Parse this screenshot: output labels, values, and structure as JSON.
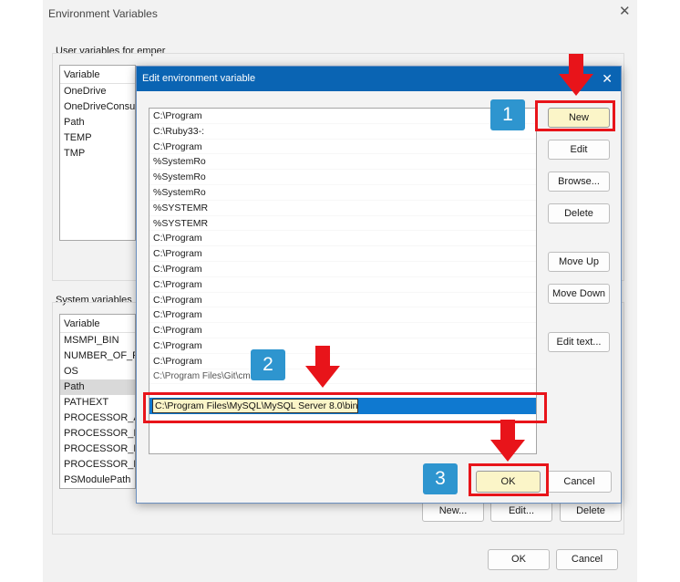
{
  "outer": {
    "title": "Environment Variables",
    "user_group_label": "User variables for emper",
    "user_list_header": "Variable",
    "user_vars": [
      "OneDrive",
      "OneDriveConsum",
      "Path",
      "TEMP",
      "TMP"
    ],
    "system_group_label": "System variables",
    "system_list_header": "Variable",
    "system_vars": [
      "MSMPI_BIN",
      "NUMBER_OF_PR",
      "OS",
      "Path",
      "PATHEXT",
      "PROCESSOR_ARC",
      "PROCESSOR_IDE",
      "PROCESSOR_LEV",
      "PROCESSOR_REV",
      "PSModulePath"
    ],
    "buttons": {
      "new": "New...",
      "edit": "Edit...",
      "delete": "Delete",
      "ok": "OK",
      "cancel": "Cancel"
    }
  },
  "inner": {
    "title": "Edit environment variable",
    "paths": [
      "C:\\Program",
      "C:\\Ruby33-:",
      "C:\\Program",
      "%SystemRo",
      "%SystemRo",
      "%SystemRo",
      "%SYSTEMR",
      "%SYSTEMR",
      "C:\\Program",
      "C:\\Program",
      "C:\\Program",
      "C:\\Program",
      "C:\\Program",
      "C:\\Program",
      "C:\\Program",
      "C:\\Program",
      "C:\\Program",
      "C:\\Program Files\\Git\\cmd"
    ],
    "editing_value": "C:\\Program Files\\MySQL\\MySQL Server 8.0\\bin",
    "buttons": {
      "new": "New",
      "edit": "Edit",
      "browse": "Browse...",
      "delete": "Delete",
      "move_up": "Move Up",
      "move_down": "Move Down",
      "edit_text": "Edit text...",
      "ok": "OK",
      "cancel": "Cancel"
    }
  },
  "annotations": {
    "step1": "1",
    "step2": "2",
    "step3": "3"
  },
  "colors": {
    "title_bar": "#0a64b3",
    "highlight": "#e8141a",
    "badge": "#2e95cf",
    "selection": "#0f79d0"
  }
}
